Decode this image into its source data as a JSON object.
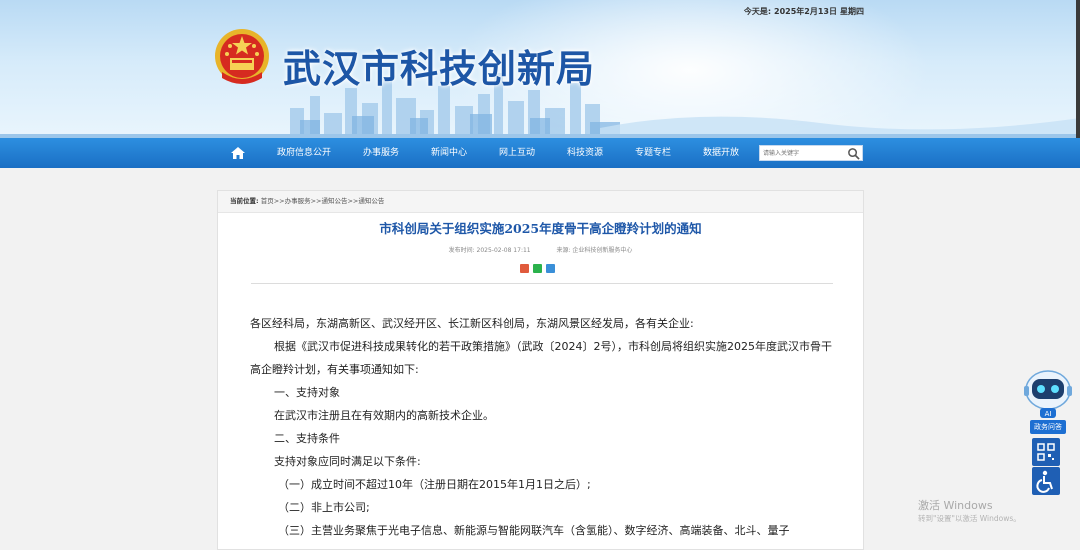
{
  "header": {
    "site_title": "武汉市科技创新局",
    "date_label": "今天是:",
    "date_value": "2025年2月13日",
    "weekday": "星期四"
  },
  "nav": {
    "items": [
      "政府信息公开",
      "办事服务",
      "新闻中心",
      "网上互动",
      "科技资源",
      "专题专栏",
      "数据开放"
    ],
    "search_placeholder": "请输入关键字"
  },
  "breadcrumb": {
    "label": "当前位置:",
    "trail": "首页>>办事服务>>通知公告>>通知公告"
  },
  "article": {
    "title": "市科创局关于组织实施2025年度骨干高企瞪羚计划的通知",
    "publish_label": "发布时间:",
    "publish_time": "2025-02-08 17:11",
    "source_label": "来源:",
    "source": "企业科技创新服务中心",
    "paragraphs": [
      "各区经科局，东湖高新区、武汉经开区、长江新区科创局，东湖风景区经发局，各有关企业:",
      "根据《武汉市促进科技成果转化的若干政策措施》（武政〔2024〕2号），市科创局将组织实施2025年度武汉市骨干高企瞪羚计划，有关事项通知如下:",
      "一、支持对象",
      "在武汉市注册且在有效期内的高新技术企业。",
      "二、支持条件",
      "支持对象应同时满足以下条件:",
      "（一）成立时间不超过10年（注册日期在2015年1月1日之后）;",
      "（二）非上市公司;",
      "（三）主营业务聚焦于光电子信息、新能源与智能网联汽车（含氢能）、数字经济、高端装备、北斗、量子"
    ]
  },
  "widgets": {
    "ai_label": "政务问答"
  },
  "watermark": {
    "line1": "激活 Windows",
    "line2": "转到\"设置\"以激活 Windows。"
  },
  "colors": {
    "nav_bg": "#1a6fc4",
    "title_blue": "#1d56a6",
    "article_title": "#1e57a8"
  }
}
